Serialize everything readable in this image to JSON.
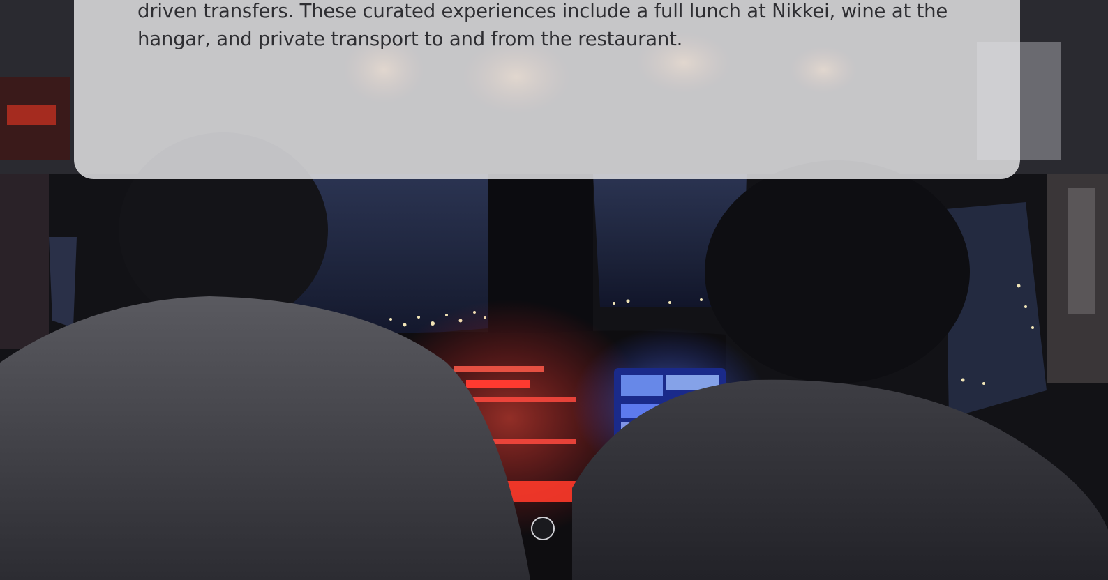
{
  "card": {
    "text": "driven transfers. These curated experiences include a full lunch at Nikkei, wine at the hangar, and private transport to and from the restaurant."
  },
  "background_photo": {
    "subject": "night cockpit view",
    "colors": {
      "sky": "#1c2440",
      "panel_red": "#ff3030",
      "display_blue": "#5a78ff",
      "city_lights": "#f2e6b8",
      "silhouette": "#141418"
    }
  }
}
